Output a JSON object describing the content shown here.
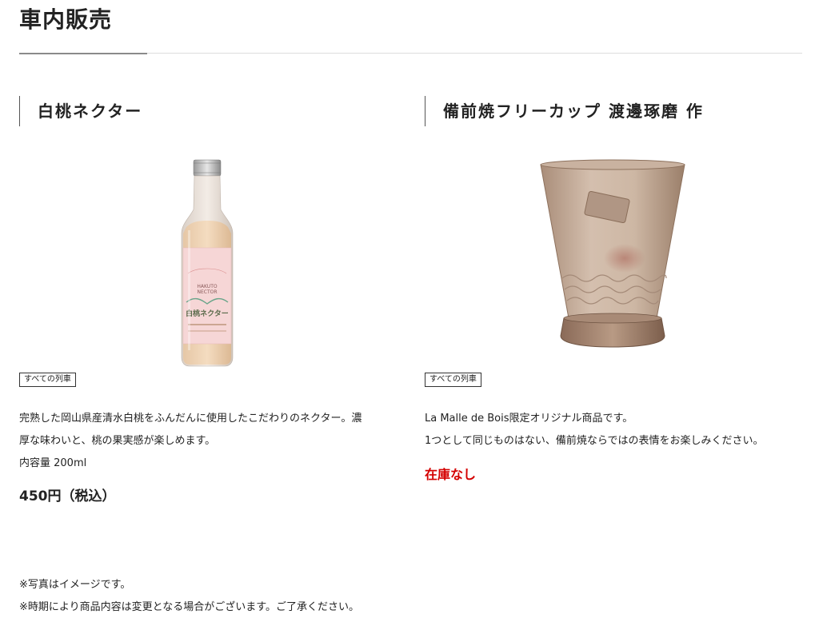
{
  "page": {
    "title": "車内販売"
  },
  "products": [
    {
      "name": "白桃ネクター",
      "tag": "すべての列車",
      "image_icon": "peach-nectar-bottle-image",
      "label_lines": [
        "HAKUTO",
        "NECTOR",
        "白桃ネクター"
      ],
      "description_lines": [
        "完熟した岡山県産清水白桃をふんだんに使用したこだわりのネクター。濃",
        "厚な味わいと、桃の果実感が楽しめます。",
        "内容量 200ml"
      ],
      "price": "450円（税込）"
    },
    {
      "name": "備前焼フリーカップ 渡邊琢磨 作",
      "tag": "すべての列車",
      "image_icon": "bizen-ware-cup-image",
      "description_lines": [
        "La Malle de Bois限定オリジナル商品です。",
        "1つとして同じものはない、備前焼ならではの表情をお楽しみください。"
      ],
      "stock_status": "在庫なし",
      "stock_color": "#d40000"
    }
  ],
  "notes": [
    "※写真はイメージです。",
    "※時期により商品内容は変更となる場合がございます。ご了承ください。"
  ]
}
